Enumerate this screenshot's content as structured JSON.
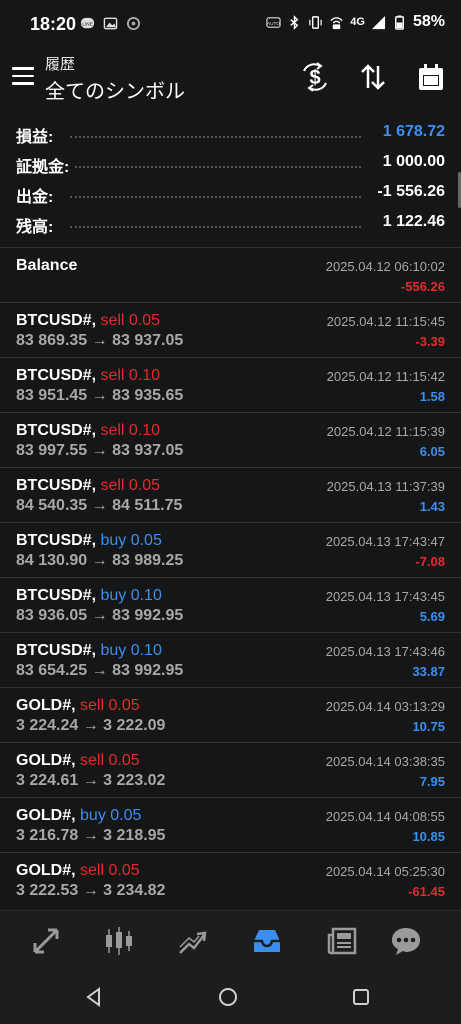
{
  "status_bar": {
    "time": "18:20",
    "network": "4G",
    "battery": "58%",
    "left_icons": [
      "line-icon",
      "gallery-icon",
      "app-icon"
    ],
    "right_icons": [
      "auto-icon",
      "bluetooth-icon",
      "vibrate-icon",
      "wifi-lte-icon",
      "signal-icon",
      "battery-icon"
    ]
  },
  "app_bar": {
    "subtitle": "履歴",
    "title": "全てのシンボル",
    "actions": [
      "currency-exchange-icon",
      "sort-icon",
      "calendar-icon"
    ]
  },
  "summary": [
    {
      "label": "損益:",
      "value": "1 678.72",
      "color": "#3b8ff0"
    },
    {
      "label": "証拠金:",
      "value": "1 000.00",
      "color": "#ffffff"
    },
    {
      "label": "出金:",
      "value": "-1 556.26",
      "color": "#ffffff"
    },
    {
      "label": "残高:",
      "value": "1 122.46",
      "color": "#ffffff"
    }
  ],
  "balance": {
    "label": "Balance",
    "time": "2025.04.12 06:10:02",
    "amount": "-556.26"
  },
  "trades": [
    {
      "symbol": "BTCUSD#,",
      "action": "sell 0.05",
      "side": "sell",
      "prices": "83 869.35 → 83 937.05",
      "time": "2025.04.12 11:15:45",
      "profit": "-3.39"
    },
    {
      "symbol": "BTCUSD#,",
      "action": "sell 0.10",
      "side": "sell",
      "prices": "83 951.45 → 83 935.65",
      "time": "2025.04.12 11:15:42",
      "profit": "1.58"
    },
    {
      "symbol": "BTCUSD#,",
      "action": "sell 0.10",
      "side": "sell",
      "prices": "83 997.55 → 83 937.05",
      "time": "2025.04.12 11:15:39",
      "profit": "6.05"
    },
    {
      "symbol": "BTCUSD#,",
      "action": "sell 0.05",
      "side": "sell",
      "prices": "84 540.35 → 84 511.75",
      "time": "2025.04.13 11:37:39",
      "profit": "1.43"
    },
    {
      "symbol": "BTCUSD#,",
      "action": "buy 0.05",
      "side": "buy",
      "prices": "84 130.90 → 83 989.25",
      "time": "2025.04.13 17:43:47",
      "profit": "-7.08"
    },
    {
      "symbol": "BTCUSD#,",
      "action": "buy 0.10",
      "side": "buy",
      "prices": "83 936.05 → 83 992.95",
      "time": "2025.04.13 17:43:45",
      "profit": "5.69"
    },
    {
      "symbol": "BTCUSD#,",
      "action": "buy 0.10",
      "side": "buy",
      "prices": "83 654.25 → 83 992.95",
      "time": "2025.04.13 17:43:46",
      "profit": "33.87"
    },
    {
      "symbol": "GOLD#,",
      "action": "sell 0.05",
      "side": "sell",
      "prices": "3 224.24 → 3 222.09",
      "time": "2025.04.14 03:13:29",
      "profit": "10.75"
    },
    {
      "symbol": "GOLD#,",
      "action": "sell 0.05",
      "side": "sell",
      "prices": "3 224.61 → 3 223.02",
      "time": "2025.04.14 03:38:35",
      "profit": "7.95"
    },
    {
      "symbol": "GOLD#,",
      "action": "buy 0.05",
      "side": "buy",
      "prices": "3 216.78 → 3 218.95",
      "time": "2025.04.14 04:08:55",
      "profit": "10.85"
    },
    {
      "symbol": "GOLD#,",
      "action": "sell 0.05",
      "side": "sell",
      "prices": "3 222.53 → 3 234.82",
      "time": "2025.04.14 05:25:30",
      "profit": "-61.45"
    }
  ],
  "bottom_nav": [
    {
      "icon": "quotes-icon",
      "active": false
    },
    {
      "icon": "chart-icon",
      "active": false
    },
    {
      "icon": "trade-icon",
      "active": false
    },
    {
      "icon": "history-icon",
      "active": true
    },
    {
      "icon": "news-icon",
      "active": false
    },
    {
      "icon": "messages-icon",
      "active": false
    }
  ],
  "colors": {
    "background": "#151617",
    "positive": "#3b8ff0",
    "negative": "#e52b2b",
    "sell": "#e52b2b",
    "buy": "#3b8ff0",
    "muted": "#a8a8a8",
    "active_nav": "#3b8ff0",
    "inactive_nav": "#9a9a9a"
  }
}
